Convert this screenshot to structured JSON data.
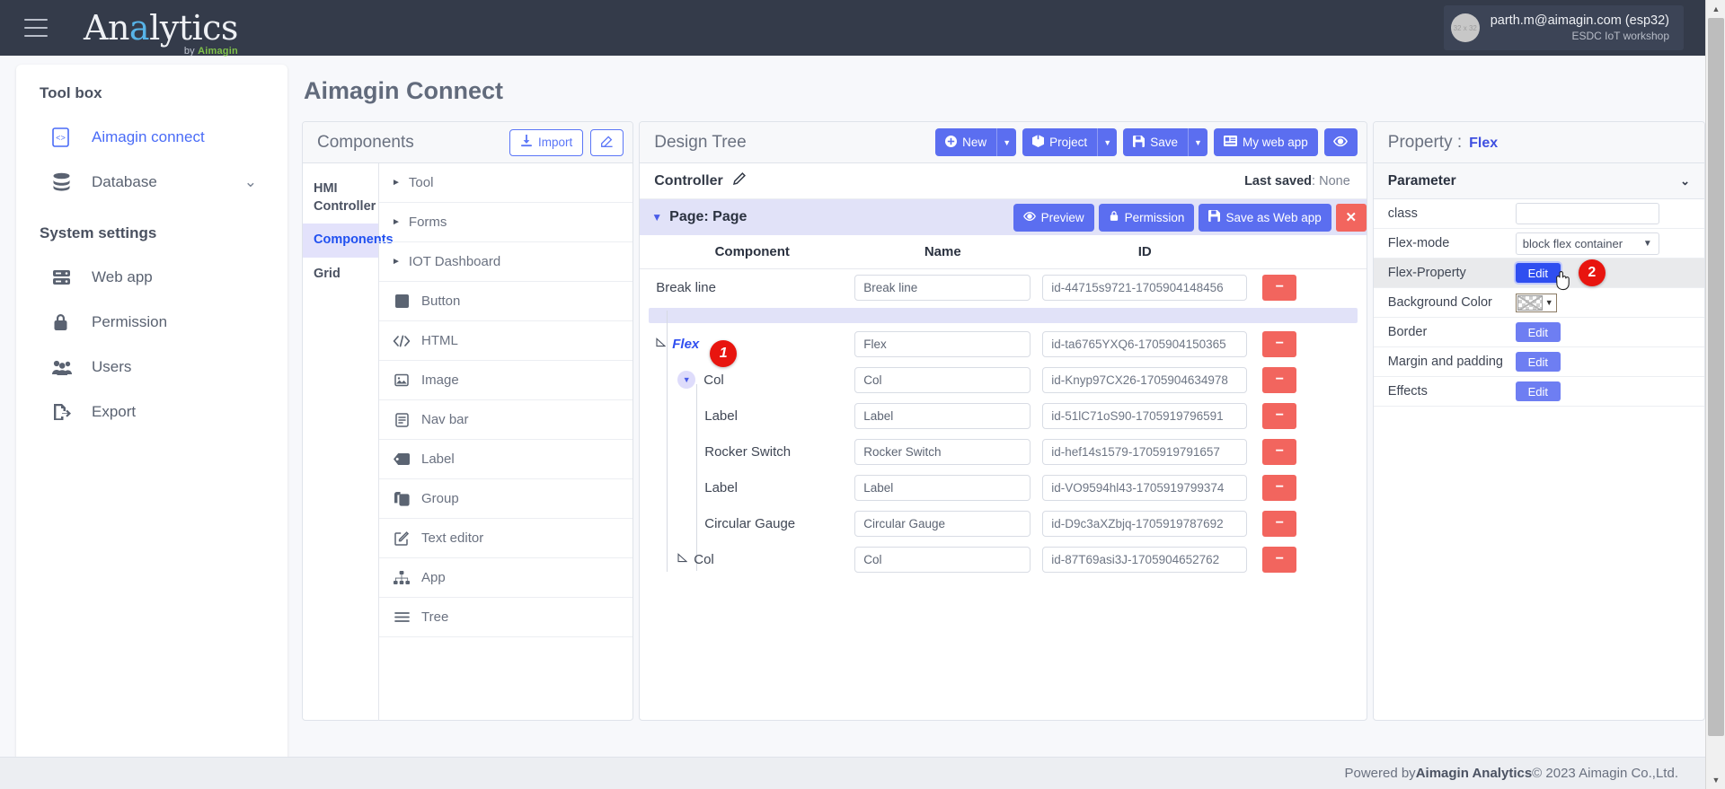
{
  "navbar": {
    "menu_icon": "hamburger-icon",
    "logo_text_1": "An",
    "logo_accent": "a",
    "logo_text_2": "lytics",
    "logo_sub_prefix": "by ",
    "logo_sub_brand": "Aimagin",
    "avatar_placeholder": "32 x 32",
    "user_email": "parth.m@aimagin.com (esp32)",
    "user_role": "ESDC IoT workshop"
  },
  "sidebar": {
    "section_1": "Tool box",
    "section_2": "System settings",
    "items": [
      {
        "label": "Aimagin connect",
        "icon": "code-file-icon",
        "active": true
      },
      {
        "label": "Database",
        "icon": "database-icon",
        "caret": "⌄"
      }
    ],
    "system_items": [
      {
        "label": "Web app",
        "icon": "server-icon"
      },
      {
        "label": "Permission",
        "icon": "lock-icon"
      },
      {
        "label": "Users",
        "icon": "users-icon"
      },
      {
        "label": "Export",
        "icon": "export-icon"
      }
    ]
  },
  "page": {
    "title": "Aimagin Connect"
  },
  "components_panel": {
    "title": "Components",
    "import_label": "Import",
    "import_icon": "download-icon",
    "edit_icon": "pencil-square-icon",
    "tabs": [
      {
        "label": "HMI Controller",
        "active": false
      },
      {
        "label": "Components",
        "active": true
      },
      {
        "label": "Grid",
        "active": false
      }
    ],
    "groups": [
      {
        "label": "Tool",
        "icon": "triangle-right-icon"
      },
      {
        "label": "Forms",
        "icon": "triangle-right-icon"
      },
      {
        "label": "IOT Dashboard",
        "icon": "triangle-right-icon"
      }
    ],
    "items": [
      {
        "label": "Button",
        "icon": "square-filled-icon"
      },
      {
        "label": "HTML",
        "icon": "code-icon"
      },
      {
        "label": "Image",
        "icon": "image-icon"
      },
      {
        "label": "Nav bar",
        "icon": "list-document-icon"
      },
      {
        "label": "Label",
        "icon": "tag-icon"
      },
      {
        "label": "Group",
        "icon": "copy-icon"
      },
      {
        "label": "Text editor",
        "icon": "pencil-square-icon"
      },
      {
        "label": "App",
        "icon": "sitemap-icon"
      },
      {
        "label": "Tree",
        "icon": "lines-icon"
      }
    ]
  },
  "design_tree": {
    "title": "Design Tree",
    "toolbar": [
      {
        "label": "New",
        "icon": "plus-circle-icon",
        "has_split": true
      },
      {
        "label": "Project",
        "icon": "box-icon",
        "has_split": true
      },
      {
        "label": "Save",
        "icon": "floppy-icon",
        "has_split": true
      },
      {
        "label": "My web app",
        "icon": "card-icon",
        "has_split": false
      },
      {
        "label": "",
        "icon": "eye-icon",
        "has_split": false
      }
    ],
    "controller_label": "Controller",
    "controller_edit_icon": "pencil-icon",
    "last_saved_label": "Last saved",
    "last_saved_value": "None",
    "page_row": {
      "caret": "▼",
      "label": "Page: Page",
      "buttons": [
        {
          "label": "Preview",
          "icon": "eye-icon"
        },
        {
          "label": "Permission",
          "icon": "lock-icon"
        },
        {
          "label": "Save as Web app",
          "icon": "floppy-icon"
        }
      ],
      "close_label": "✕"
    },
    "headers": {
      "component": "Component",
      "name": "Name",
      "id": "ID"
    },
    "rows": [
      {
        "component": "Break line",
        "name": "Break line",
        "id": "id-44715s9721-1705904148456",
        "indent": 0,
        "marker": "none",
        "selected": false
      },
      {
        "drop_indicator": true
      },
      {
        "component": "Flex",
        "name": "Flex",
        "id": "id-ta6765YXQ6-1705904150365",
        "indent": 0,
        "marker": "triangle-outline",
        "selected": true,
        "badge": "1"
      },
      {
        "component": "Col",
        "name": "Col",
        "id": "id-Knyp97CX26-1705904634978",
        "indent": 1,
        "marker": "circle-down",
        "selected": false
      },
      {
        "component": "Label",
        "name": "Label",
        "id": "id-51lC71oS90-1705919796591",
        "indent": 2,
        "marker": "none",
        "selected": false
      },
      {
        "component": "Rocker Switch",
        "name": "Rocker Switch",
        "id": "id-hef14s1579-1705919791657",
        "indent": 2,
        "marker": "none",
        "selected": false
      },
      {
        "component": "Label",
        "name": "Label",
        "id": "id-VO9594hl43-1705919799374",
        "indent": 2,
        "marker": "none",
        "selected": false
      },
      {
        "component": "Circular Gauge",
        "name": "Circular Gauge",
        "id": "id-D9c3aXZbjq-1705919787692",
        "indent": 2,
        "marker": "none",
        "selected": false
      },
      {
        "component": "Col",
        "name": "Col",
        "id": "id-87T69asi3J-1705904652762",
        "indent": 1,
        "marker": "triangle-outline",
        "selected": false
      }
    ],
    "delete_label": "−"
  },
  "property_panel": {
    "title": "Property :",
    "target": "Flex",
    "parameter_label": "Parameter",
    "parameter_caret": "⌄",
    "rows": [
      {
        "label": "class",
        "control": "input",
        "value": "",
        "highlight": false
      },
      {
        "label": "Flex-mode",
        "control": "select",
        "value": "block flex container",
        "highlight": false
      },
      {
        "label": "Flex-Property",
        "control": "button",
        "value": "Edit",
        "highlight": true,
        "focused": true,
        "badge": "2"
      },
      {
        "label": "Background Color",
        "control": "color",
        "value": "",
        "highlight": false
      },
      {
        "label": "Border",
        "control": "button",
        "value": "Edit",
        "highlight": false
      },
      {
        "label": "Margin and padding",
        "control": "button",
        "value": "Edit",
        "highlight": false
      },
      {
        "label": "Effects",
        "control": "button",
        "value": "Edit",
        "highlight": false
      }
    ]
  },
  "footer": {
    "prefix": "Powered by ",
    "brand": "Aimagin Analytics",
    "suffix": " © 2023 Aimagin Co.,Ltd."
  },
  "colors": {
    "navbar_bg": "#343b4a",
    "primary": "#5b6ef0",
    "accent_blue": "#2f4ef0",
    "danger": "#f2655e",
    "badge_red": "#e8150f",
    "selected_row": "#e1e2f8",
    "logo_accent": "#57b4e8",
    "logo_brand_green": "#7fc24a"
  }
}
